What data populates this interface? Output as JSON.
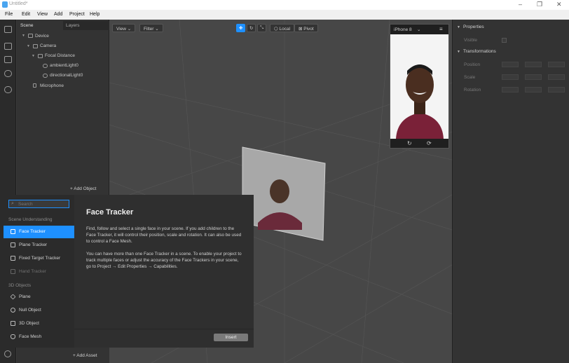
{
  "window": {
    "title": "Untitled*"
  },
  "window_controls": {
    "minimize": "–",
    "restore": "❐",
    "close": "✕"
  },
  "menu": [
    "File",
    "Edit",
    "View",
    "Add",
    "Project",
    "Help"
  ],
  "scene_panel": {
    "tabs": [
      "Scene",
      "Layers"
    ],
    "tree": [
      {
        "label": "Device",
        "icon": "device-icon"
      },
      {
        "label": "Camera",
        "icon": "camera-icon"
      },
      {
        "label": "Focal Distance",
        "icon": "focal-distance-icon"
      },
      {
        "label": "ambientLight0",
        "icon": "light-icon"
      },
      {
        "label": "directionalLight0",
        "icon": "light-icon"
      },
      {
        "label": "Microphone",
        "icon": "microphone-icon"
      }
    ],
    "add_object": "Add Object",
    "add_asset": "Add Asset"
  },
  "viewport_toolbar": {
    "view": "View",
    "filter": "Filter",
    "local": "Local",
    "pivot": "Pivot"
  },
  "phone_preview": {
    "device": "iPhone 8"
  },
  "properties": {
    "header": "Properties",
    "visible_label": "Visible",
    "transformations_header": "Transformations",
    "rows": [
      "Position",
      "Scale",
      "Rotation"
    ],
    "field_placeholder": "-"
  },
  "add_object_dialog": {
    "search_placeholder": "Search",
    "categories": [
      {
        "name": "Scene Understanding",
        "items": [
          {
            "label": "Face Tracker",
            "selected": true,
            "enabled": true
          },
          {
            "label": "Plane Tracker",
            "selected": false,
            "enabled": true
          },
          {
            "label": "Fixed Target Tracker",
            "selected": false,
            "enabled": true
          },
          {
            "label": "Hand Tracker",
            "selected": false,
            "enabled": false
          }
        ]
      },
      {
        "name": "3D Objects",
        "items": [
          {
            "label": "Plane",
            "selected": false,
            "enabled": true
          },
          {
            "label": "Null Object",
            "selected": false,
            "enabled": true
          },
          {
            "label": "3D Object",
            "selected": false,
            "enabled": true
          },
          {
            "label": "Face Mesh",
            "selected": false,
            "enabled": true
          }
        ]
      }
    ],
    "detail_title": "Face Tracker",
    "detail_p1": "Find, follow and select a single face in your scene. If you add children to the Face Tracker, it will control their position, scale and rotation. It can also be used to control a Face Mesh.",
    "detail_p2": "You can have more than one Face Tracker in a scene. To enable your project to track multiple faces or adjust the accuracy of the Face Trackers in your scene, go to Project → Edit Properties → Capabilities.",
    "insert": "Insert"
  },
  "colors": {
    "accent": "#1e90ff",
    "panel": "#333333",
    "viewport": "#474747"
  }
}
